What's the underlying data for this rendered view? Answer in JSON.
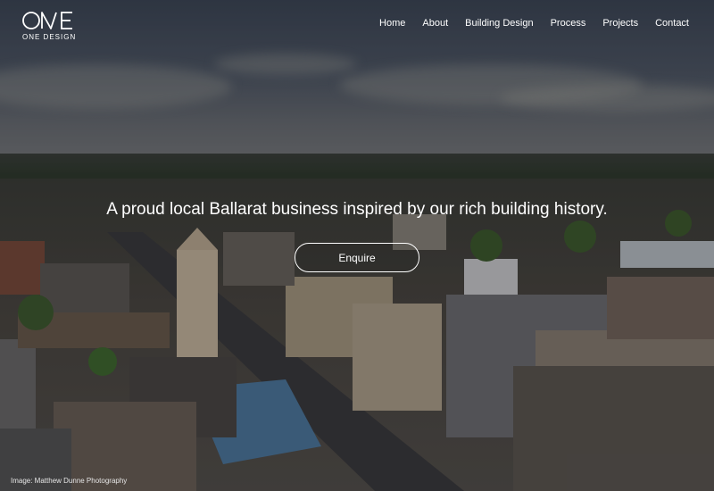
{
  "logo": {
    "mark": "ONE",
    "text": "ONE DESIGN"
  },
  "nav": {
    "items": [
      {
        "label": "Home"
      },
      {
        "label": "About"
      },
      {
        "label": "Building Design"
      },
      {
        "label": "Process"
      },
      {
        "label": "Projects"
      },
      {
        "label": "Contact"
      }
    ]
  },
  "hero": {
    "headline": "A proud local Ballarat business inspired by our rich building history.",
    "cta_label": "Enquire",
    "image_credit": "Image: Matthew Dunne Photography"
  }
}
